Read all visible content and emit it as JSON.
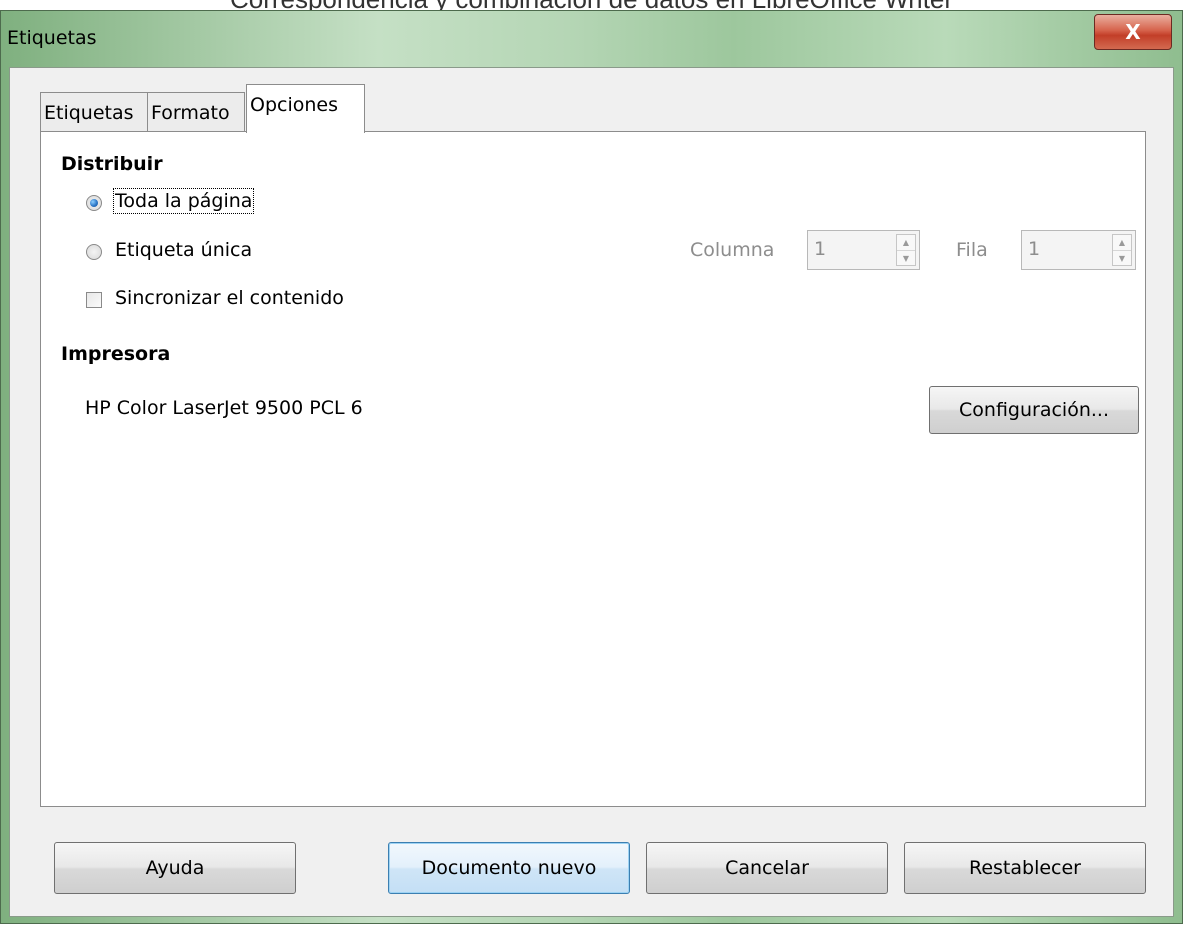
{
  "background_caption": "Correspondencia y combinación de datos en LibreOffice Writer",
  "window": {
    "title": "Etiquetas",
    "close_glyph": "X",
    "close_icon": "close-icon"
  },
  "tabs": [
    {
      "label": "Etiquetas",
      "active": false
    },
    {
      "label": "Formato",
      "active": false
    },
    {
      "label": "Opciones",
      "active": true
    }
  ],
  "distribute": {
    "heading": "Distribuir",
    "options": [
      {
        "label": "Toda la página",
        "checked": true
      },
      {
        "label": "Etiqueta única",
        "checked": false
      }
    ],
    "sync": {
      "label": "Sincronizar el contenido",
      "checked": false
    },
    "column": {
      "label": "Columna",
      "value": "1",
      "enabled": false
    },
    "row": {
      "label": "Fila",
      "value": "1",
      "enabled": false
    }
  },
  "printer": {
    "heading": "Impresora",
    "name": "HP Color LaserJet 9500 PCL 6",
    "setup_label": "Configuración..."
  },
  "buttons": {
    "help": "Ayuda",
    "new_document": "Documento nuevo",
    "cancel": "Cancelar",
    "reset": "Restablecer"
  },
  "colors": {
    "title_bar": "#b5d6b5",
    "close_button": "#c23e28",
    "default_button_border": "#3c7fb1",
    "radio_selected": "#2d78c8"
  }
}
